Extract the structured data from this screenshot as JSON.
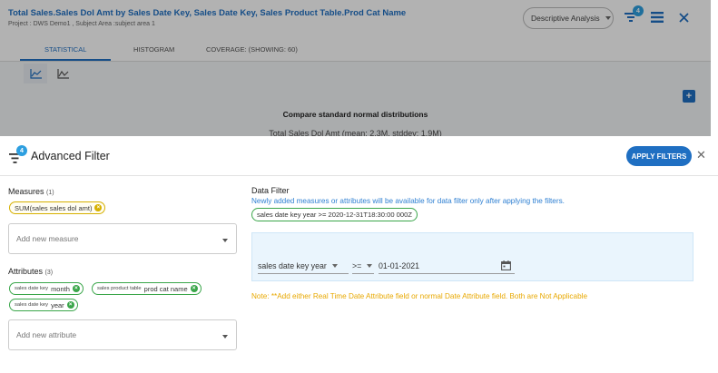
{
  "report": {
    "title": "Total Sales.Sales Dol Amt by Sales Date Key, Sales Date Key, Sales Product Table.Prod Cat Name",
    "subtitle": "Project : DWS Demo1 ,  Subject Area :subject area 1",
    "analysis_dropdown": "Descriptive Analysis",
    "filter_count": "4"
  },
  "tabs": [
    {
      "label": "STATISTICAL",
      "active": true
    },
    {
      "label": "HISTOGRAM",
      "active": false
    },
    {
      "label": "COVERAGE: (SHOWING: 60)",
      "active": false
    }
  ],
  "chart_area": {
    "heading": "Compare standard normal distributions",
    "distribution_label": "Total Sales Dol Amt (mean: 2.3M, stddev: 1.9M)"
  },
  "filter_panel": {
    "title": "Advanced Filter",
    "badge": "4",
    "apply_label": "APPLY FILTERS",
    "measures": {
      "label": "Measures",
      "count": "(1)",
      "chips": [
        {
          "text": "SUM(sales sales dol amt)"
        }
      ],
      "placeholder": "Add new measure"
    },
    "attributes": {
      "label": "Attributes",
      "count": "(3)",
      "chips": [
        {
          "prefix": "sales date key",
          "name": "month"
        },
        {
          "prefix": "sales product table",
          "name": "prod cat name"
        },
        {
          "prefix": "sales date key",
          "name": "year"
        }
      ],
      "placeholder": "Add new attribute"
    },
    "data_filter": {
      "label": "Data Filter",
      "note": "Newly added measures or attributes will be available for data filter only after applying the filters.",
      "active_filter": "sales date key year >= 2020-12-31T18:30:00 000Z",
      "condition": {
        "field": "sales date key year",
        "operator": ">=",
        "value": "01-01-2021"
      },
      "warning": "Note: **Add either Real Time Date Attribute field or normal Date Attribute field. Both are Not Applicable"
    }
  },
  "colors": {
    "primary": "#1f6fc2",
    "badge": "#2d9fe0",
    "measure_chip": "#d6b000",
    "attribute_chip": "#3aa64a",
    "warning": "#e8a800"
  }
}
